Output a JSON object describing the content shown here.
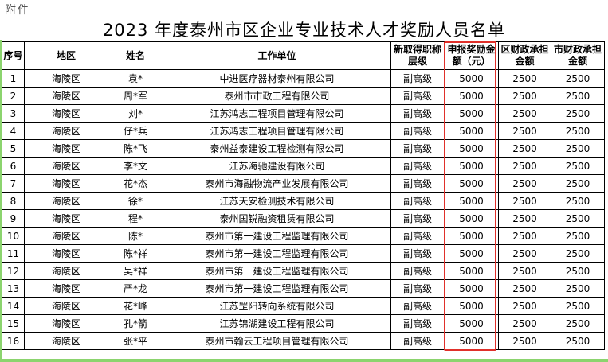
{
  "header": {
    "attachment_label": "附件",
    "title": "2023 年度泰州市区企业专业技术人才奖励人员名单"
  },
  "table": {
    "columns": {
      "seq": "序号",
      "district": "地区",
      "name": "姓名",
      "unit": "工作单位",
      "level": "新取得职称层级",
      "amount": "申报奖励金额（元）",
      "district_finance": "区财政承担金额",
      "city_finance": "市财政承担金额"
    },
    "rows": [
      {
        "seq": "1",
        "district": "海陵区",
        "name": "袁*",
        "unit": "中进医疗器材泰州有限公司",
        "level": "副高级",
        "amount": "5000",
        "district_finance": "2500",
        "city_finance": "2500"
      },
      {
        "seq": "2",
        "district": "海陵区",
        "name": "周*军",
        "unit": "泰州市市政工程有限公司",
        "level": "副高级",
        "amount": "5000",
        "district_finance": "2500",
        "city_finance": "2500"
      },
      {
        "seq": "3",
        "district": "海陵区",
        "name": "刘*",
        "unit": "江苏鸿志工程项目管理有限公司",
        "level": "副高级",
        "amount": "5000",
        "district_finance": "2500",
        "city_finance": "2500"
      },
      {
        "seq": "4",
        "district": "海陵区",
        "name": "仔*兵",
        "unit": "江苏鸿志工程项目管理有限公司",
        "level": "副高级",
        "amount": "5000",
        "district_finance": "2500",
        "city_finance": "2500"
      },
      {
        "seq": "5",
        "district": "海陵区",
        "name": "陈*飞",
        "unit": "泰州益泰建设工程检测有限公司",
        "level": "副高级",
        "amount": "5000",
        "district_finance": "2500",
        "city_finance": "2500"
      },
      {
        "seq": "6",
        "district": "海陵区",
        "name": "李*文",
        "unit": "江苏海驰建设有限公司",
        "level": "副高级",
        "amount": "5000",
        "district_finance": "2500",
        "city_finance": "2500"
      },
      {
        "seq": "7",
        "district": "海陵区",
        "name": "花*杰",
        "unit": "泰州市海融物流产业发展有限公司",
        "level": "副高级",
        "amount": "5000",
        "district_finance": "2500",
        "city_finance": "2500"
      },
      {
        "seq": "8",
        "district": "海陵区",
        "name": "徐*",
        "unit": "江苏天安检测技术有限公司",
        "level": "副高级",
        "amount": "5000",
        "district_finance": "2500",
        "city_finance": "2500"
      },
      {
        "seq": "9",
        "district": "海陵区",
        "name": "程*",
        "unit": "泰州国锐融资租赁有限公司",
        "level": "副高级",
        "amount": "5000",
        "district_finance": "2500",
        "city_finance": "2500"
      },
      {
        "seq": "10",
        "district": "海陵区",
        "name": "陈*",
        "unit": "泰州市第一建设工程监理有限公司",
        "level": "副高级",
        "amount": "5000",
        "district_finance": "2500",
        "city_finance": "2500"
      },
      {
        "seq": "11",
        "district": "海陵区",
        "name": "陈*祥",
        "unit": "泰州市第一建设工程监理有限公司",
        "level": "副高级",
        "amount": "5000",
        "district_finance": "2500",
        "city_finance": "2500"
      },
      {
        "seq": "12",
        "district": "海陵区",
        "name": "吴*祥",
        "unit": "泰州市第一建设工程监理有限公司",
        "level": "副高级",
        "amount": "5000",
        "district_finance": "2500",
        "city_finance": "2500"
      },
      {
        "seq": "13",
        "district": "海陵区",
        "name": "严*龙",
        "unit": "泰州市第一建设工程监理有限公司",
        "level": "副高级",
        "amount": "5000",
        "district_finance": "2500",
        "city_finance": "2500"
      },
      {
        "seq": "14",
        "district": "海陵区",
        "name": "花*峰",
        "unit": "江苏罡阳转向系统有限公司",
        "level": "副高级",
        "amount": "5000",
        "district_finance": "2500",
        "city_finance": "2500"
      },
      {
        "seq": "15",
        "district": "海陵区",
        "name": "孔*箭",
        "unit": "江苏锦湖建设工程有限公司",
        "level": "副高级",
        "amount": "5000",
        "district_finance": "2500",
        "city_finance": "2500"
      },
      {
        "seq": "16",
        "district": "海陵区",
        "name": "张*平",
        "unit": "泰州市翰云工程项目管理有限公司",
        "level": "副高级",
        "amount": "5000",
        "district_finance": "2500",
        "city_finance": "2500"
      }
    ]
  },
  "colors": {
    "highlight": "#e0302a",
    "green_accent": "#8bd46e"
  }
}
